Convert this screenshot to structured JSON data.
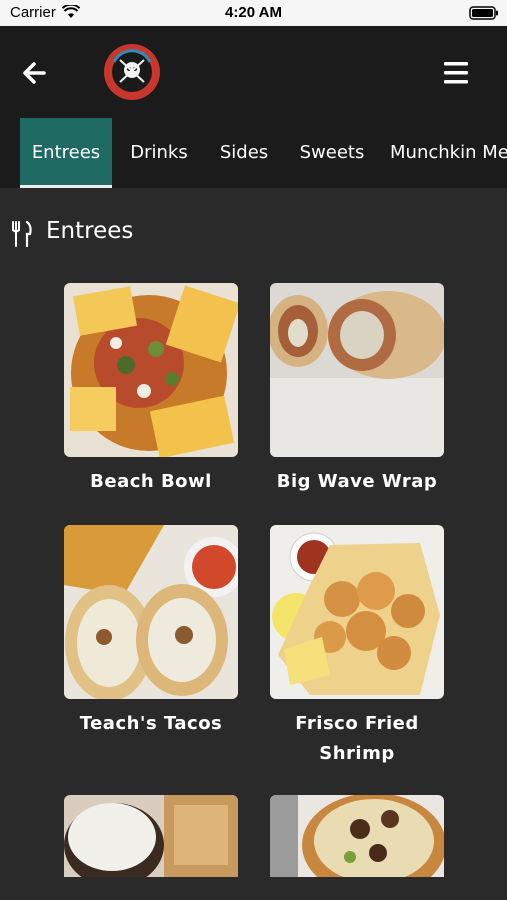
{
  "status_bar": {
    "carrier": "Carrier",
    "time": "4:20 AM"
  },
  "header": {
    "back_icon": "arrow-left-icon",
    "logo": "restaurant-logo",
    "menu_icon": "hamburger-menu-icon"
  },
  "tabs": [
    {
      "label": "Entrees",
      "active": true
    },
    {
      "label": "Drinks"
    },
    {
      "label": "Sides"
    },
    {
      "label": "Sweets"
    },
    {
      "label": "Munchkin Menu"
    }
  ],
  "section": {
    "icon": "fork-knife-icon",
    "title": "Entrees"
  },
  "items": [
    {
      "name": "Beach Bowl"
    },
    {
      "name": "Big Wave Wrap"
    },
    {
      "name": "Teach's Tacos"
    },
    {
      "name": "Frisco Fried Shrimp"
    },
    {
      "name": ""
    },
    {
      "name": ""
    }
  ],
  "colors": {
    "accent": "#1f6b64",
    "background": "#2a2a2a",
    "header": "#1b1b1b"
  }
}
